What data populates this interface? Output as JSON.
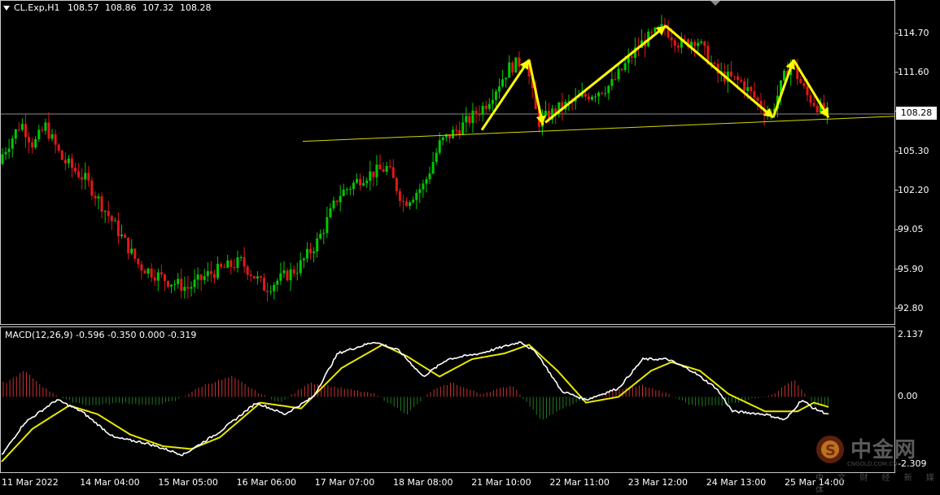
{
  "header": {
    "symbol": "CL.Exp,H1",
    "open": "108.57",
    "high": "108.86",
    "low": "107.32",
    "close": "108.28"
  },
  "macd_header": "MACD(12,26,9) -0.596 -0.350 0.000 -0.319",
  "current_price_label": "108.28",
  "watermark": {
    "brand": "中金网",
    "site": "CNGOLD.COM.CN",
    "tagline": "中 文 财 经 新 媒 体"
  },
  "colors": {
    "bull": "#00c800",
    "bear": "#e01818",
    "macd_line": "#ffffff",
    "signal_line": "#e8e800",
    "hist_pos": "#c83030",
    "hist_neg": "#1f7a1f",
    "trendline": "#d8d800",
    "arrow": "#ffff00"
  },
  "chart_data": {
    "type": "candlestick",
    "instrument": "CL.Exp",
    "timeframe": "H1",
    "price_axis": {
      "ticks": [
        "114.70",
        "111.60",
        "108.50",
        "105.30",
        "102.20",
        "99.05",
        "95.90",
        "92.80"
      ],
      "range": [
        91.6,
        117.3
      ]
    },
    "macd_axis": {
      "ticks": [
        "2.137",
        "0.00",
        "-2.309"
      ],
      "range": [
        -2.6,
        2.4
      ]
    },
    "date_labels": [
      "11 Mar 2022",
      "14 Mar 04:00",
      "15 Mar 05:00",
      "16 Mar 06:00",
      "17 Mar 07:00",
      "18 Mar 08:00",
      "21 Mar 10:00",
      "22 Mar 11:00",
      "23 Mar 12:00",
      "24 Mar 13:00",
      "25 Mar 14:00"
    ],
    "price_path": [
      [
        0,
        104.3
      ],
      [
        30,
        107.6
      ],
      [
        45,
        105.8
      ],
      [
        60,
        107.3
      ],
      [
        80,
        104.7
      ],
      [
        110,
        103.0
      ],
      [
        145,
        99.4
      ],
      [
        175,
        96.2
      ],
      [
        210,
        95.0
      ],
      [
        235,
        94.4
      ],
      [
        260,
        95.5
      ],
      [
        300,
        96.5
      ],
      [
        330,
        94.4
      ],
      [
        370,
        96.0
      ],
      [
        395,
        98.2
      ],
      [
        420,
        101.8
      ],
      [
        450,
        103.3
      ],
      [
        480,
        104.0
      ],
      [
        500,
        101.2
      ],
      [
        525,
        102.6
      ],
      [
        545,
        106.0
      ],
      [
        575,
        107.5
      ],
      [
        600,
        109.0
      ],
      [
        630,
        112.0
      ],
      [
        650,
        112.6
      ],
      [
        665,
        107.6
      ],
      [
        690,
        108.7
      ],
      [
        720,
        109.6
      ],
      [
        755,
        110.6
      ],
      [
        790,
        113.8
      ],
      [
        820,
        115.2
      ],
      [
        840,
        113.8
      ],
      [
        860,
        114.3
      ],
      [
        885,
        111.5
      ],
      [
        915,
        110.8
      ],
      [
        950,
        108.1
      ],
      [
        975,
        112.5
      ],
      [
        995,
        109.8
      ],
      [
        1018,
        108.28
      ]
    ],
    "macd": [
      [
        0,
        -2.1
      ],
      [
        30,
        -0.9
      ],
      [
        70,
        -0.1
      ],
      [
        100,
        -0.5
      ],
      [
        140,
        -1.4
      ],
      [
        180,
        -1.6
      ],
      [
        225,
        -2.0
      ],
      [
        270,
        -1.2
      ],
      [
        315,
        -0.2
      ],
      [
        350,
        -0.6
      ],
      [
        385,
        0.0
      ],
      [
        415,
        1.5
      ],
      [
        460,
        1.9
      ],
      [
        490,
        1.6
      ],
      [
        520,
        0.7
      ],
      [
        550,
        1.3
      ],
      [
        590,
        1.5
      ],
      [
        640,
        1.9
      ],
      [
        660,
        1.5
      ],
      [
        690,
        0.2
      ],
      [
        720,
        -0.1
      ],
      [
        760,
        0.3
      ],
      [
        790,
        1.3
      ],
      [
        820,
        1.3
      ],
      [
        850,
        0.9
      ],
      [
        880,
        0.3
      ],
      [
        900,
        -0.5
      ],
      [
        940,
        -0.6
      ],
      [
        965,
        -0.8
      ],
      [
        985,
        -0.1
      ],
      [
        1000,
        -0.4
      ],
      [
        1018,
        -0.6
      ]
    ],
    "signal": [
      [
        0,
        -2.3
      ],
      [
        40,
        -1.1
      ],
      [
        85,
        -0.3
      ],
      [
        120,
        -0.6
      ],
      [
        160,
        -1.3
      ],
      [
        200,
        -1.7
      ],
      [
        235,
        -1.8
      ],
      [
        270,
        -1.4
      ],
      [
        320,
        -0.2
      ],
      [
        370,
        -0.4
      ],
      [
        420,
        1.0
      ],
      [
        470,
        1.8
      ],
      [
        500,
        1.4
      ],
      [
        540,
        0.7
      ],
      [
        580,
        1.3
      ],
      [
        620,
        1.5
      ],
      [
        650,
        1.8
      ],
      [
        685,
        0.9
      ],
      [
        720,
        -0.2
      ],
      [
        760,
        0.0
      ],
      [
        800,
        0.9
      ],
      [
        825,
        1.2
      ],
      [
        860,
        0.9
      ],
      [
        895,
        0.1
      ],
      [
        940,
        -0.5
      ],
      [
        980,
        -0.5
      ],
      [
        1000,
        -0.2
      ],
      [
        1018,
        -0.35
      ]
    ],
    "histogram": [
      [
        8,
        0.5
      ],
      [
        30,
        0.9
      ],
      [
        55,
        0.3
      ],
      [
        80,
        -0.1
      ],
      [
        110,
        -0.3
      ],
      [
        150,
        -0.2
      ],
      [
        185,
        -0.3
      ],
      [
        215,
        -0.15
      ],
      [
        250,
        0.4
      ],
      [
        285,
        0.7
      ],
      [
        320,
        0.1
      ],
      [
        345,
        -0.2
      ],
      [
        380,
        0.5
      ],
      [
        420,
        0.3
      ],
      [
        460,
        0.1
      ],
      [
        500,
        -0.6
      ],
      [
        530,
        0.2
      ],
      [
        555,
        0.5
      ],
      [
        590,
        0.1
      ],
      [
        630,
        0.4
      ],
      [
        665,
        -0.8
      ],
      [
        700,
        -0.3
      ],
      [
        750,
        0.2
      ],
      [
        790,
        0.4
      ],
      [
        820,
        0.1
      ],
      [
        850,
        -0.3
      ],
      [
        885,
        -0.3
      ],
      [
        920,
        -0.1
      ],
      [
        950,
        0.1
      ],
      [
        975,
        0.6
      ],
      [
        1000,
        -0.3
      ],
      [
        1018,
        -0.3
      ]
    ],
    "current_price": 108.28,
    "trendline": [
      [
        372,
        106.1
      ],
      [
        1100,
        108.1
      ]
    ],
    "arrows": [
      [
        592,
        107.0,
        650,
        112.6
      ],
      [
        650,
        112.6,
        667,
        107.4
      ],
      [
        670,
        107.6,
        818,
        115.3
      ],
      [
        818,
        115.3,
        950,
        108.0
      ],
      [
        950,
        108.0,
        975,
        112.6
      ],
      [
        975,
        112.6,
        1018,
        108.0
      ]
    ],
    "watermark_time_fragment": "2.309"
  }
}
